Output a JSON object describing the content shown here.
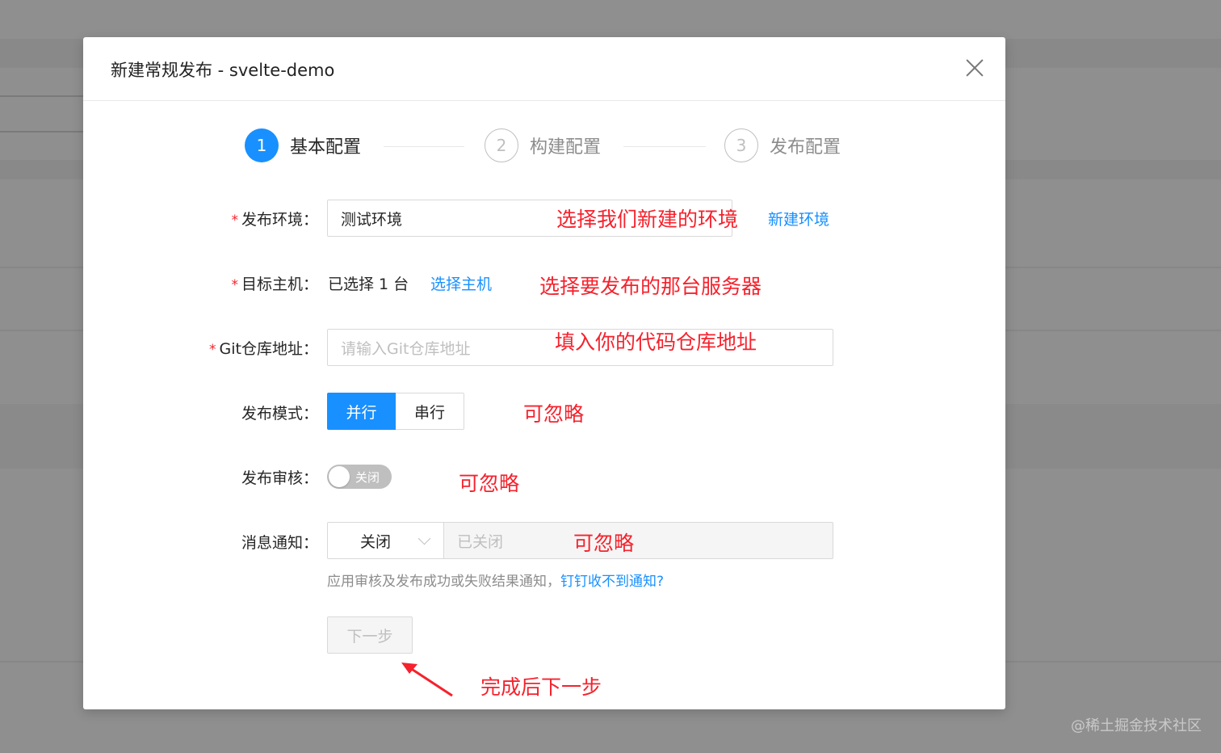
{
  "modal": {
    "title": "新建常规发布 - svelte-demo"
  },
  "steps": [
    {
      "num": "1",
      "label": "基本配置",
      "state": "active"
    },
    {
      "num": "2",
      "label": "构建配置",
      "state": "wait"
    },
    {
      "num": "3",
      "label": "发布配置",
      "state": "wait"
    }
  ],
  "form": {
    "env": {
      "required": "*",
      "label": "发布环境：",
      "value": "测试环境",
      "link": "新建环境"
    },
    "host": {
      "required": "*",
      "label": "目标主机：",
      "value": "已选择 1 台",
      "link": "选择主机"
    },
    "git": {
      "required": "*",
      "label": "Git仓库地址：",
      "placeholder": "请输入Git仓库地址"
    },
    "mode": {
      "label": "发布模式：",
      "options": [
        "并行",
        "串行"
      ],
      "selected": "并行"
    },
    "review": {
      "label": "发布审核：",
      "switch_text": "关闭",
      "on": false
    },
    "notify": {
      "label": "消息通知：",
      "select_value": "关闭",
      "input_placeholder": "已关闭",
      "help_text": "应用审核及发布成功或失败结果通知，",
      "help_link": "钉钉收不到通知?"
    },
    "next_button": "下一步"
  },
  "annotations": {
    "env": "选择我们新建的环境",
    "host": "选择要发布的那台服务器",
    "git": "填入你的代码仓库地址",
    "mode": "可忽略",
    "review": "可忽略",
    "notify": "可忽略",
    "next": "完成后下一步"
  },
  "colors": {
    "primary": "#1890ff",
    "annotation": "#f5222d",
    "overlay": "#8f8f8f"
  },
  "watermark": "@稀土掘金技术社区"
}
